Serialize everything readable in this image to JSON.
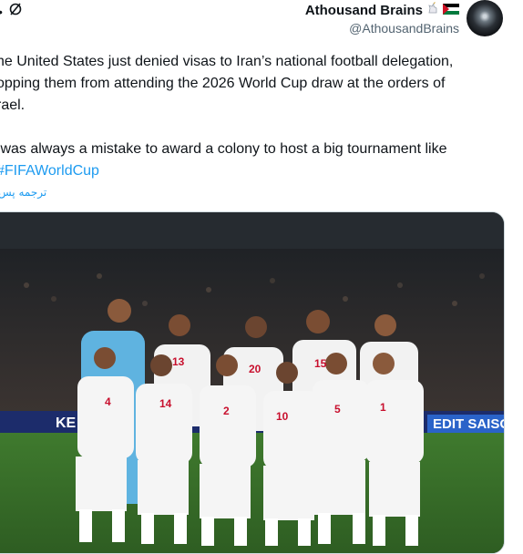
{
  "tweet": {
    "author": {
      "display_name": "Athousand Brains",
      "handle": "@AthousandBrains",
      "flag_colors": [
        "#000000",
        "#ffffff",
        "#007a3d",
        "#ce1126"
      ]
    },
    "top_icons": {
      "dot": "•",
      "grok_icon": "grok-icon"
    },
    "text_lines": [
      "he United States just denied visas to Iran’s national football delegation,",
      "opping them from attending the 2026 World Cup draw at the orders of",
      "rael.",
      "",
      " was always a mistake to award a colony to host a big tournament like"
    ],
    "hashtag": "FIFAWorldCup",
    "translate_label": "ترجمه پس",
    "media": {
      "billboard_left": "KE",
      "billboard_right": "EDIT SAISO",
      "jersey_numbers": [
        "13",
        "20",
        "15",
        "4",
        "14",
        "2",
        "10",
        "5",
        "1"
      ]
    }
  }
}
